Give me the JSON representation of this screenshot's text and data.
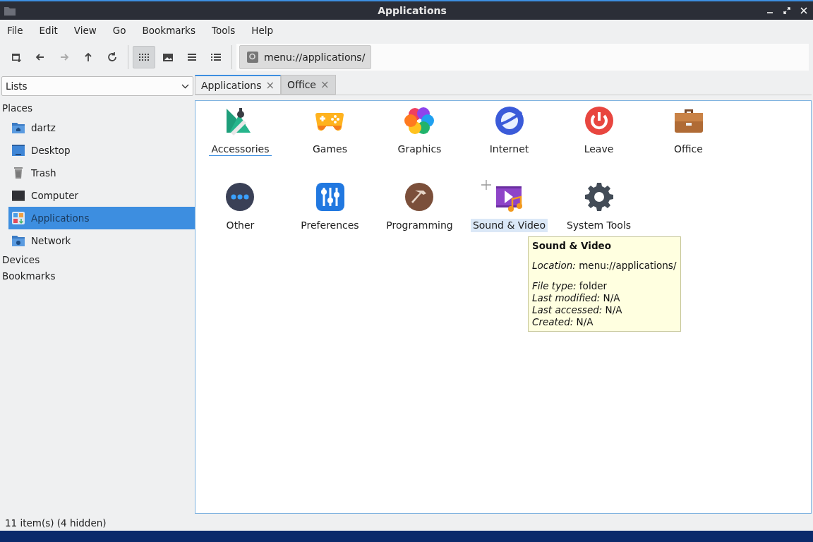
{
  "window": {
    "title": "Applications"
  },
  "menu": [
    "File",
    "Edit",
    "View",
    "Go",
    "Bookmarks",
    "Tools",
    "Help"
  ],
  "nav_buttons": [
    {
      "disabled": false
    },
    {
      "disabled": false
    },
    {
      "disabled": true
    },
    {
      "disabled": false
    },
    {
      "disabled": false
    }
  ],
  "view_modes": [
    {
      "selected": true
    },
    {
      "selected": false
    },
    {
      "selected": false
    },
    {
      "selected": false
    }
  ],
  "location": {
    "value": "menu://applications/"
  },
  "side_pane": {
    "mode": "Lists"
  },
  "tabs": [
    {
      "label": "Applications",
      "selected": true,
      "close": "×"
    },
    {
      "label": "Office",
      "selected": false,
      "close": "×"
    }
  ],
  "sidebar": {
    "sections": [
      {
        "label": "Places",
        "items": [
          {
            "label": "dartz",
            "selected": false
          },
          {
            "label": "Desktop",
            "selected": false
          },
          {
            "label": "Trash",
            "selected": false
          },
          {
            "label": "Computer",
            "selected": false
          },
          {
            "label": "Applications",
            "selected": true
          },
          {
            "label": "Network",
            "selected": false
          }
        ]
      },
      {
        "label": "Devices"
      },
      {
        "label": "Bookmarks"
      }
    ]
  },
  "items": [
    {
      "label": "Accessories",
      "selected": false,
      "focused": true
    },
    {
      "label": "Games",
      "selected": false,
      "focused": false
    },
    {
      "label": "Graphics",
      "selected": false,
      "focused": false
    },
    {
      "label": "Internet",
      "selected": false,
      "focused": false
    },
    {
      "label": "Leave",
      "selected": false,
      "focused": false
    },
    {
      "label": "Office",
      "selected": false,
      "focused": false
    },
    {
      "label": "Other",
      "selected": false,
      "focused": false
    },
    {
      "label": "Preferences",
      "selected": false,
      "focused": false
    },
    {
      "label": "Programming",
      "selected": false,
      "focused": false
    },
    {
      "label": "Sound & Video",
      "selected": true,
      "focused": false
    },
    {
      "label": "System Tools",
      "selected": false,
      "focused": false
    }
  ],
  "tooltip": {
    "title": "Sound & Video",
    "lines": [
      [
        "*Location:* menu://applications/"
      ],
      [
        "*File type:* folder",
        "*Last modified:* N/A",
        "*Last accessed:* N/A",
        "*Created:* N/A"
      ]
    ]
  },
  "status_bar": {
    "text": "11 item(s) (4 hidden)"
  }
}
